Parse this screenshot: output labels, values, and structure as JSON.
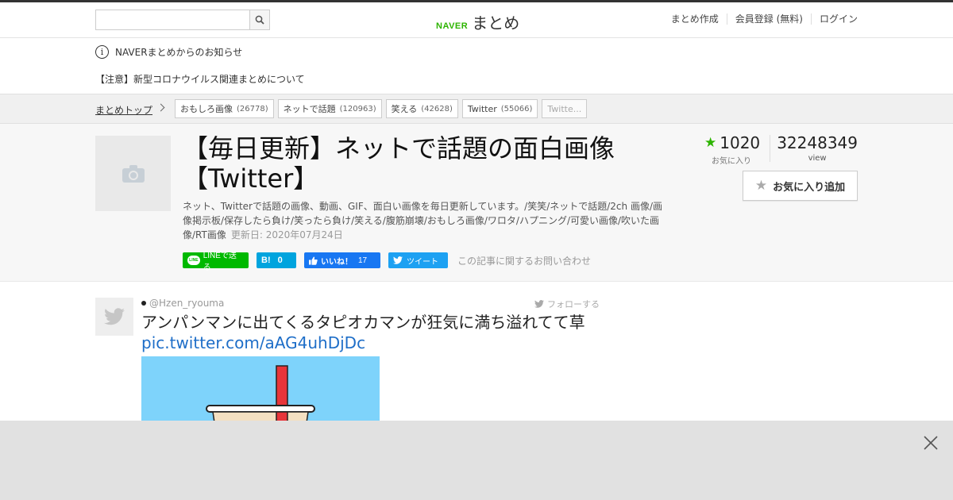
{
  "header": {
    "search": {
      "placeholder": "",
      "value": ""
    },
    "logo": {
      "brand": "NAVER",
      "name": "まとめ"
    },
    "links": [
      "まとめ作成",
      "会員登録 (無料)",
      "ログイン"
    ]
  },
  "notices": {
    "heading": "NAVERまとめからのお知らせ",
    "item": "【注意】新型コロナウイルス関連まとめについて"
  },
  "breadcrumb": {
    "top": "まとめトップ",
    "tags": [
      {
        "label": "おもしろ画像",
        "count": "(26778)"
      },
      {
        "label": "ネットで話題",
        "count": "(120963)"
      },
      {
        "label": "笑える",
        "count": "(42628)"
      },
      {
        "label": "Twitter",
        "count": "(55066)"
      },
      {
        "label": "Twitte...",
        "count": ""
      }
    ]
  },
  "article": {
    "title": "【毎日更新】ネットで話題の面白画像【Twitter】",
    "description": "ネット、Twitterで話題の画像、動画、GIF、面白い画像を毎日更新しています。/笑笑/ネットで話題/2ch 画像/画像掲示板/保存したら負け/笑ったら負け/笑える/腹筋崩壊/おもしろ画像/ワロタ/ハプニング/可愛い画像/吹いた画像/RT画像",
    "updated": "更新日: 2020年07月24日",
    "favorites": {
      "count": "1020",
      "label": "お気に入り"
    },
    "views": {
      "count": "32248349",
      "label": "view"
    },
    "fav_button": "お気に入り追加",
    "share": {
      "line": "LINEで送る",
      "hatena_icon": "B!",
      "hatena_count": "0",
      "fb_label": "いいね！",
      "fb_count": "17",
      "tweet": "ツイート",
      "contact": "この記事に関するお問い合わせ"
    },
    "colors": {
      "brand_green": "#2db400",
      "line": "#00b900",
      "hatena": "#00a4de",
      "facebook": "#1877f2",
      "twitter": "#1da1f2",
      "link": "#1e6ec8"
    }
  },
  "tweet": {
    "user": "@Hzen_ryouma",
    "follow": "フォローする",
    "text": "アンパンマンに出てくるタピオカマンが狂気に満ち溢れてて草",
    "link": "pic.twitter.com/aAG4uhDjDc"
  },
  "icons": [
    "search-icon",
    "info-icon",
    "chevron-right-icon",
    "camera-icon",
    "star-icon",
    "twitter-bird-icon",
    "close-icon"
  ]
}
